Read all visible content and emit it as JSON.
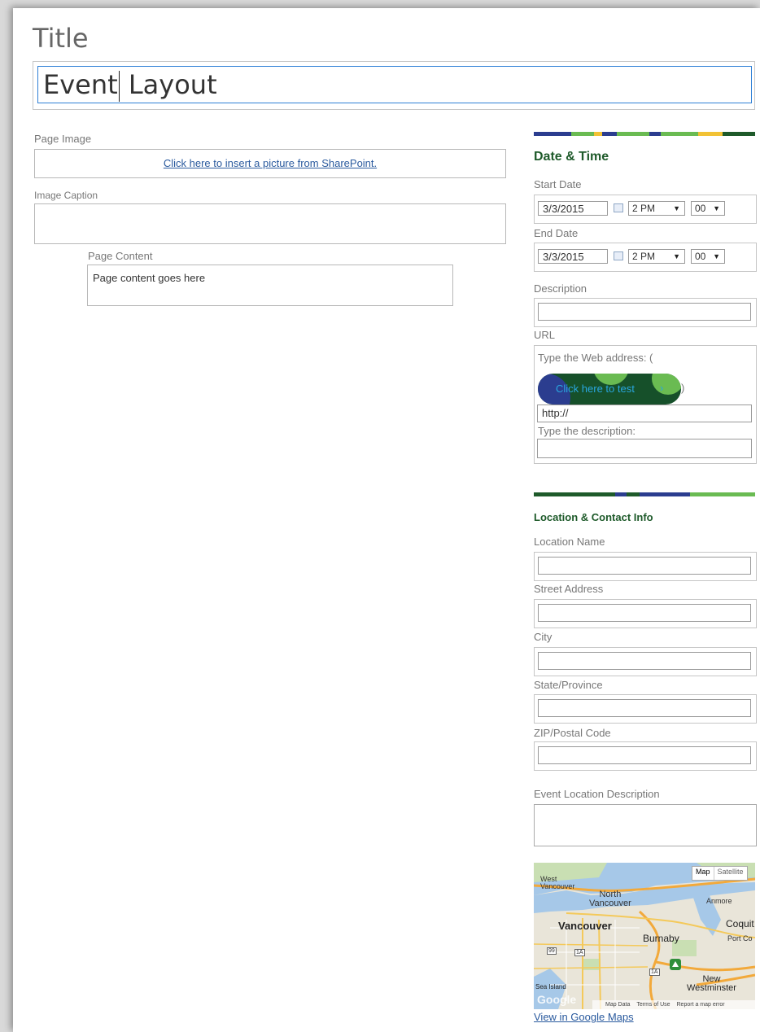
{
  "title": {
    "label": "Title",
    "value_before_caret": "Event",
    "value_after_caret": " Layout"
  },
  "left": {
    "page_image_label": "Page Image",
    "insert_picture_link": "Click here to insert a picture from SharePoint.",
    "image_caption_label": "Image Caption",
    "image_caption_value": "",
    "page_content_label": "Page Content",
    "page_content_value": "Page content goes here"
  },
  "date_time": {
    "heading": "Date & Time",
    "start_date_label": "Start Date",
    "start_date": "3/3/2015",
    "start_hour": "2 PM",
    "start_minute": "00",
    "end_date_label": "End Date",
    "end_date": "3/3/2015",
    "end_hour": "2 PM",
    "end_minute": "00",
    "description_label": "Description",
    "url_label": "URL",
    "url_web_address_prefix": "Type the Web address: (",
    "url_test_button": "Click here to test",
    "url_test_suffix": ")",
    "url_value": "http://",
    "url_description_label": "Type the description:"
  },
  "location": {
    "heading": "Location & Contact Info",
    "location_name_label": "Location Name",
    "street_address_label": "Street Address",
    "city_label": "City",
    "state_label": "State/Province",
    "zip_label": "ZIP/Postal Code",
    "event_location_description_label": "Event Location Description"
  },
  "map": {
    "map_button": "Map",
    "satellite_button": "Satellite",
    "places": {
      "west_vancouver": "West\nVancouver",
      "north_vancouver": "North\nVancouver",
      "anmore": "Anmore",
      "vancouver": "Vancouver",
      "burnaby": "Burnaby",
      "coquitlam": "Coquit",
      "port_coquitlam": "Port Co",
      "new_westminster": "New\nWestminster",
      "sea_island": "Sea Island"
    },
    "road_labels": {
      "hwy99": "99",
      "hwy1a": "1A",
      "hwy1a_2": "1A"
    },
    "google_logo": "Google",
    "map_data": "Map Data",
    "terms": "Terms of Use",
    "report": "Report a map error",
    "view_link": "View in Google Maps"
  },
  "colors": {
    "accent_link": "#2a5a9e",
    "section_title": "#1e5a2a",
    "stripe_navy": "#2b3d8f",
    "stripe_green": "#6abb52",
    "stripe_dark_green": "#1e5a2a",
    "stripe_yellow": "#f2c234",
    "focus_border": "#2e7fd6"
  }
}
